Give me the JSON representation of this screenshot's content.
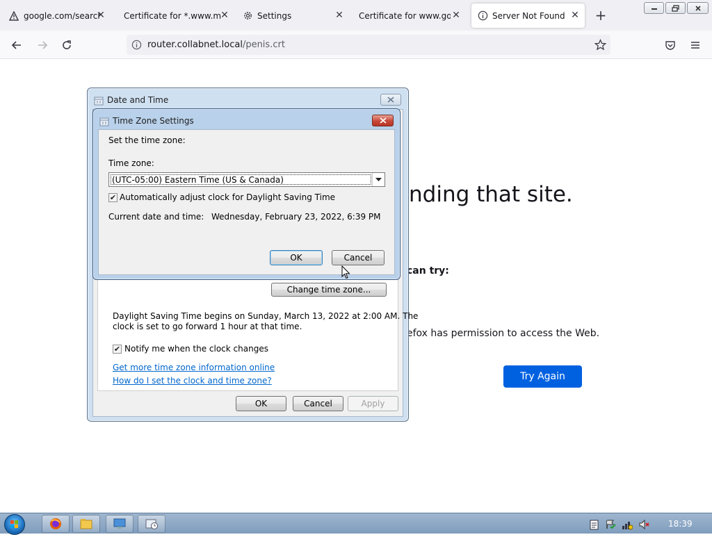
{
  "browser": {
    "tabs": [
      {
        "label": "google.com/search?c",
        "icon": "warning-icon"
      },
      {
        "label": "Certificate for *.www.moz",
        "icon": "none"
      },
      {
        "label": "Settings",
        "icon": "gear-icon"
      },
      {
        "label": "Certificate for www.google",
        "icon": "none"
      },
      {
        "label": "Server Not Found",
        "icon": "info-icon",
        "selected": true
      }
    ],
    "url_host": "router.collabnet.local",
    "url_path": "/penis.crt"
  },
  "error_page": {
    "title_fragment": "nding that site.",
    "subtitle_fragment": "can try:",
    "body_fragment": "efox has permission to access the Web.",
    "try_again_label": "Try Again"
  },
  "date_time_dialog": {
    "title": "Date and Time",
    "change_time_zone_label": "Change time zone...",
    "dst_info_line1": "Daylight Saving Time begins on Sunday, March 13, 2022 at 2:00 AM. The",
    "dst_info_line2": "clock is set to go forward 1 hour at that time.",
    "notify_label": "Notify me when the clock changes",
    "notify_checked": true,
    "link_more_info": "Get more time zone information online",
    "link_how_set": "How do I set the clock and time zone?",
    "ok_label": "OK",
    "cancel_label": "Cancel",
    "apply_label": "Apply"
  },
  "time_zone_dialog": {
    "title": "Time Zone Settings",
    "set_label": "Set the time zone:",
    "tz_label": "Time zone:",
    "tz_value": "(UTC-05:00) Eastern Time (US & Canada)",
    "auto_dst_label": "Automatically adjust clock for Daylight Saving Time",
    "auto_dst_checked": true,
    "current_label": "Current date and time:",
    "current_value": "Wednesday, February 23, 2022, 6:39 PM",
    "ok_label": "OK",
    "cancel_label": "Cancel"
  },
  "taskbar": {
    "clock": "18:39",
    "items": [
      "firefox-icon",
      "explorer-folder-icon",
      "control-panel-icon",
      "date-time-icon"
    ]
  },
  "colors": {
    "accent_button": "#0061e0",
    "link": "#0066cc",
    "close_button_red": "#c7483a"
  }
}
